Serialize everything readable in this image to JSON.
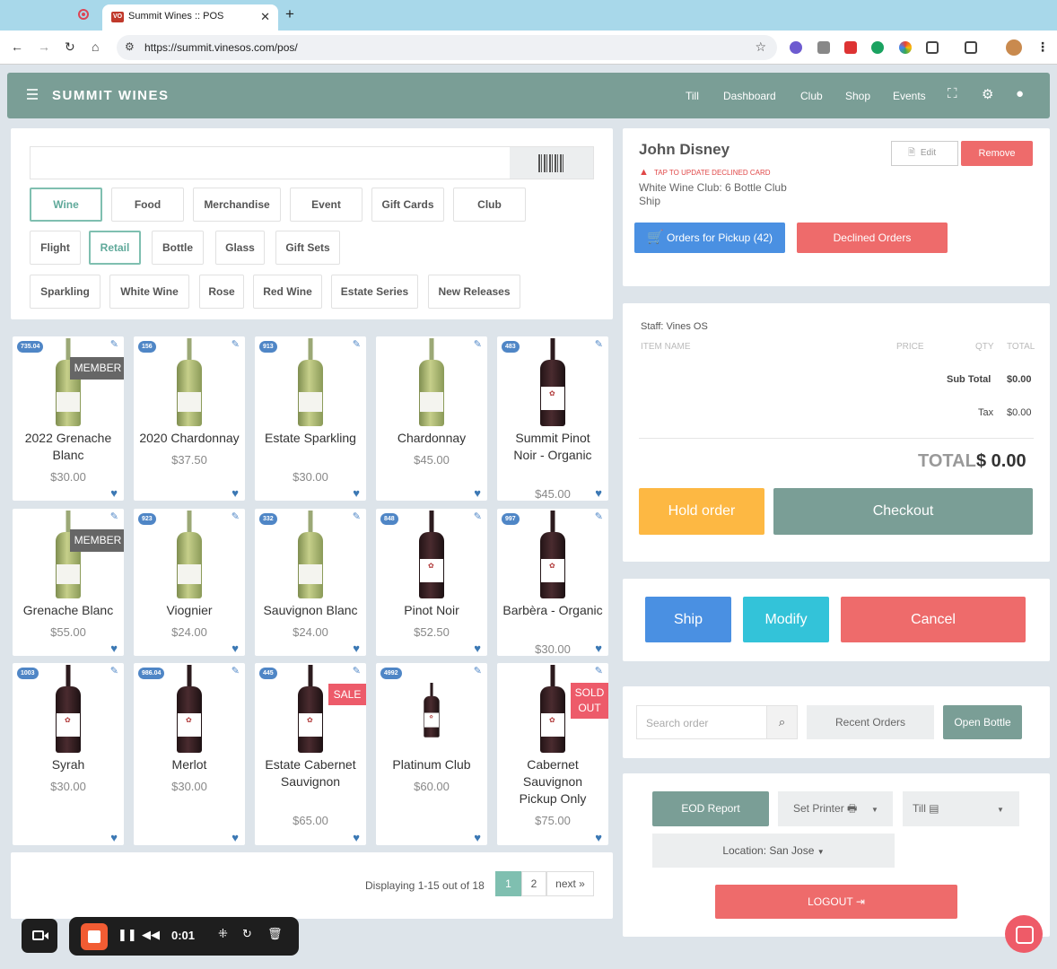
{
  "browser": {
    "tab_title": "Summit Wines :: POS",
    "tab_close": "✕",
    "new_tab": "+",
    "url": "https://summit.vinesos.com/pos/"
  },
  "header": {
    "brand": "SUMMIT WINES",
    "nav": [
      "Till",
      "Dashboard",
      "Club",
      "Shop",
      "Events"
    ]
  },
  "categories": {
    "row1": [
      "Wine",
      "Food",
      "Merchandise",
      "Event",
      "Gift Cards",
      "Club"
    ],
    "row2": [
      "Flight",
      "Retail",
      "Bottle",
      "Glass",
      "Gift Sets"
    ],
    "row3": [
      "Sparkling",
      "White Wine",
      "Rose",
      "Red Wine",
      "Estate Series",
      "New Releases"
    ],
    "active": [
      "Wine",
      "Retail"
    ]
  },
  "products": [
    {
      "badge": "735.04",
      "name": "2022 Grenache Blanc",
      "price": "$30.00",
      "tag": "MEMBER",
      "wine": "white"
    },
    {
      "badge": "156",
      "name": "2020 Chardonnay",
      "price": "$37.50",
      "tag": "",
      "wine": "white"
    },
    {
      "badge": "913",
      "name": "Estate Sparkling",
      "price": "$30.00",
      "tag": "",
      "wine": "white"
    },
    {
      "badge": "",
      "name": "Chardonnay",
      "price": "$45.00",
      "tag": "",
      "wine": "white"
    },
    {
      "badge": "483",
      "name": "Summit Pinot Noir - Organic",
      "price": "$45.00",
      "tag": "",
      "wine": "red"
    },
    {
      "badge": "",
      "name": "Grenache Blanc",
      "price": "$55.00",
      "tag": "MEMBER",
      "wine": "white"
    },
    {
      "badge": "923",
      "name": "Viognier",
      "price": "$24.00",
      "tag": "",
      "wine": "white"
    },
    {
      "badge": "332",
      "name": "Sauvignon Blanc",
      "price": "$24.00",
      "tag": "",
      "wine": "white"
    },
    {
      "badge": "848",
      "name": "Pinot Noir",
      "price": "$52.50",
      "tag": "",
      "wine": "red"
    },
    {
      "badge": "997",
      "name": "Barbèra - Organic",
      "price": "$30.00",
      "tag": "",
      "wine": "red"
    },
    {
      "badge": "1003",
      "name": "Syrah",
      "price": "$30.00",
      "tag": "",
      "wine": "red"
    },
    {
      "badge": "986.04",
      "name": "Merlot",
      "price": "$30.00",
      "tag": "",
      "wine": "red"
    },
    {
      "badge": "445",
      "name": "Estate Cabernet Sauvignon",
      "price": "$65.00",
      "tag": "SALE",
      "wine": "red"
    },
    {
      "badge": "4992",
      "name": "Platinum Club",
      "price": "$60.00",
      "tag": "",
      "wine": "red-small"
    },
    {
      "badge": "",
      "name": "Cabernet Sauvignon Pickup Only",
      "price": "$75.00",
      "tag": "SOLD OUT",
      "wine": "red"
    }
  ],
  "pagination": {
    "summary": "Displaying 1-15 out of 18",
    "pages": [
      "1",
      "2"
    ],
    "current": "1",
    "next": "next »"
  },
  "customer": {
    "name": "John Disney",
    "edit": "Edit",
    "remove": "Remove",
    "alert": "TAP TO UPDATE DECLINED CARD",
    "club": "White Wine Club: 6 Bottle Club",
    "delivery": "Ship",
    "pickup_btn": "Orders for Pickup (42)",
    "declined_btn": "Declined Orders"
  },
  "order": {
    "staff": "Staff: Vines OS",
    "columns": [
      "ITEM NAME",
      "PRICE",
      "QTY",
      "TOTAL"
    ],
    "subtotal_label": "Sub Total",
    "subtotal": "$0.00",
    "tax_label": "Tax",
    "tax": "$0.00",
    "total_label": "TOTAL",
    "total": "$ 0.00",
    "hold": "Hold order",
    "checkout": "Checkout"
  },
  "actions": {
    "ship": "Ship",
    "modify": "Modify",
    "cancel": "Cancel"
  },
  "search": {
    "placeholder": "Search order",
    "recent": "Recent Orders",
    "open_bottle": "Open Bottle"
  },
  "admin": {
    "eod": "EOD Report",
    "printer": "Set Printer",
    "till": "Till",
    "location": "Location: San Jose",
    "logout": "LOGOUT"
  },
  "recorder": {
    "time": "0:01"
  },
  "colors": {
    "header": "#7a9e96",
    "accent_teal": "#7fbfb0",
    "blue": "#4a90e2",
    "red": "#ee6b6b",
    "yellow": "#fdb843",
    "cyan": "#33c3d9"
  }
}
